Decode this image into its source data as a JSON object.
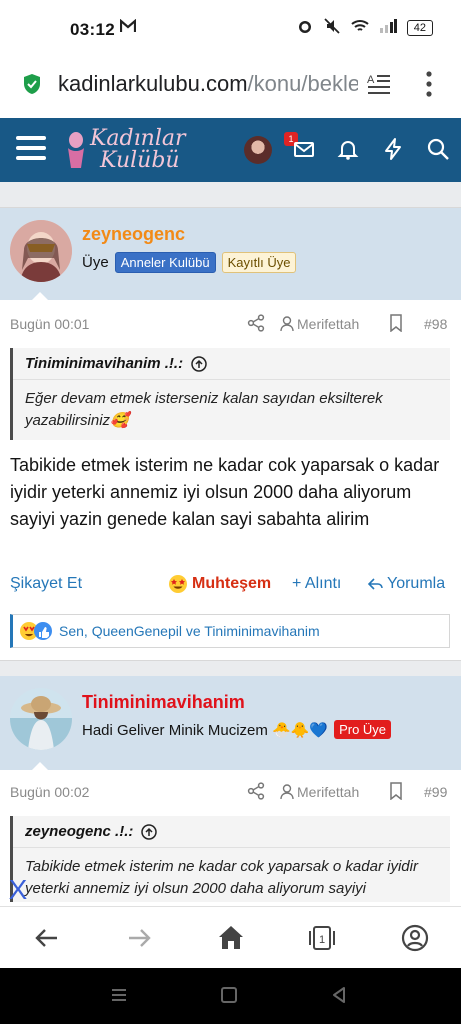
{
  "status_bar": {
    "time": "03:12",
    "battery": "42"
  },
  "address_bar": {
    "url_host": "kadinlarkulubu.com",
    "url_path": "/konu/bekle"
  },
  "site_header": {
    "logo_line1": "Kadınlar",
    "logo_line2": "Kulübü",
    "notification_count": "1"
  },
  "posts": [
    {
      "username": "zeyneogenc",
      "username_color": "#f28a16",
      "role": "Üye",
      "badges": [
        "Anneler Kulübü",
        "Kayıtlı Üye"
      ],
      "date": "Bugün 00:01",
      "author_link": "Merifettah",
      "post_number": "#98",
      "quote_author": "Tiniminimavihanim .!.:",
      "quote_text": "Eğer devam etmek isterseniz kalan sayıdan eksilterek yazabilirsiniz🥰",
      "body": "Tabikide etmek isterim ne kadar cok yaparsak o kadar iyidir yeterki annemiz iyi olsun 2000 daha aliyorum sayiyi yazin genede kalan sayi sabahta alirim",
      "actions": {
        "report": "Şikayet Et",
        "reaction": "Muhteşem",
        "quote": "+ Alıntı",
        "reply": "Yorumla"
      },
      "reactions_summary": "Sen, QueenGenepil ve Tiniminimavihanim"
    },
    {
      "username": "Tiniminimavihanim",
      "username_color": "#e0121b",
      "role": "Hadi Geliver Minik Mucizem 🐣🐥💙",
      "badges": [
        "Pro Üye"
      ],
      "date": "Bugün 00:02",
      "author_link": "Merifettah",
      "post_number": "#99",
      "quote_author": "zeyneogenc .!.:",
      "quote_text": "Tabikide etmek isterim ne kadar cok yaparsak o kadar iyidir yeterki annemiz iyi olsun 2000 daha aliyorum sayiyi"
    }
  ],
  "floating": {
    "close_label": "X"
  },
  "colors": {
    "header": "#185886",
    "post_head": "#d2e0ec",
    "link": "#2577b8",
    "reaction": "#d62f13"
  }
}
